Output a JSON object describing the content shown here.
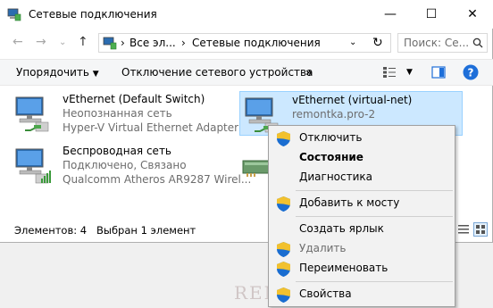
{
  "window": {
    "title": "Сетевые подключения",
    "controls": {
      "minimize": "—",
      "maximize": "☐",
      "close": "✕"
    }
  },
  "nav": {
    "breadcrumb": [
      "Все эл...",
      "Сетевые подключения"
    ],
    "search_placeholder": "Поиск: Се..."
  },
  "toolbar": {
    "organize": "Упорядочить",
    "disable_device": "Отключение сетевого устройства",
    "more": "»"
  },
  "connections": [
    {
      "name": "vEthernet (Default Switch)",
      "status": "Неопознанная сеть",
      "adapter": "Hyper-V Virtual Ethernet Adapter",
      "selected": false
    },
    {
      "name": "vEthernet (virtual-net)",
      "status": "remontka.pro-2",
      "adapter": "",
      "selected": true
    },
    {
      "name": "Беспроводная сеть",
      "status": "Подключено, Связано",
      "adapter": "Qualcomm Atheros AR9287 Wirel...",
      "selected": false
    }
  ],
  "statusbar": {
    "items": "Элементов: 4",
    "selected": "Выбран 1 элемент"
  },
  "context_menu": {
    "disable": "Отключить",
    "status": "Состояние",
    "diagnostics": "Диагностика",
    "add_to_bridge": "Добавить к мосту",
    "create_shortcut": "Создать ярлык",
    "delete": "Удалить",
    "rename": "Переименовать",
    "properties": "Свойства"
  },
  "watermark": "REMONTKA.COM",
  "colors": {
    "selection": "#cce8ff",
    "selection_border": "#99d1ff",
    "help": "#1e6fd9"
  }
}
